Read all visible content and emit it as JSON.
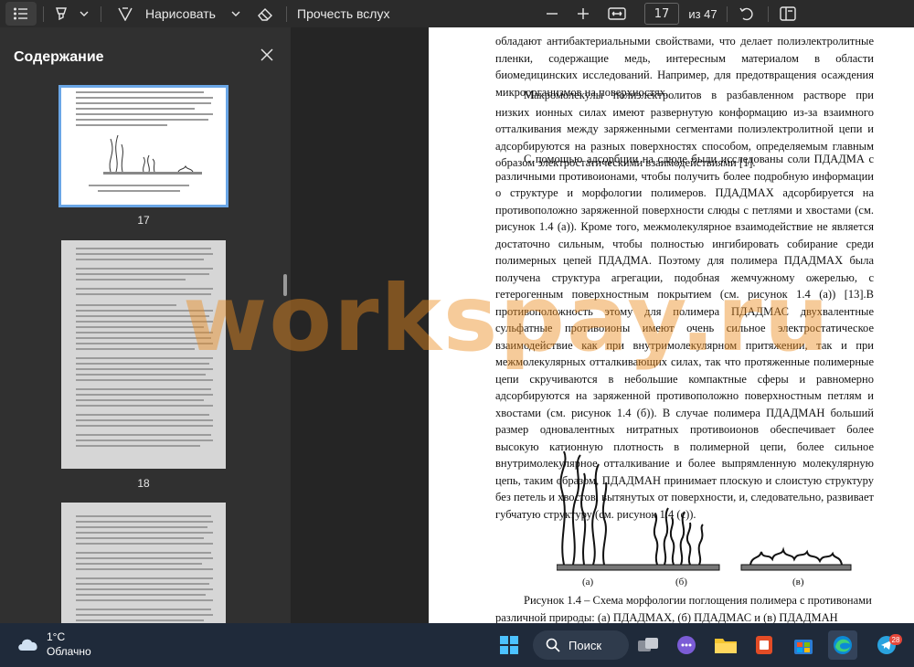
{
  "toolbar": {
    "draw_label": "Нарисовать",
    "read_aloud_label": "Прочесть вслух",
    "page_current": "17",
    "page_total": "из 47"
  },
  "sidebar": {
    "title": "Содержание",
    "thumbnails": [
      {
        "page": "17"
      },
      {
        "page": "18"
      }
    ]
  },
  "document": {
    "paragraphs": [
      "обладают антибактериальными свойствами, что делает полиэлектролитные пленки, содержащие медь, интересным материалом в области биомедицинских исследований. Например, для предотвращения осаждения микроорганизмов на поверхностях.",
      "Макромолекулы полиэлектролитов в разбавленном растворе при низких ионных силах имеют развернутую конформацию из-за взаимного отталкивания между заряженными сегментами полиэлектролитной цепи и адсорбируются на разных поверхностях способом, определяемым главным образом электростатическими взаимодействиями [1].",
      "С помощью адсорбции на слюде были исследованы соли ПДАДМА с различными противоионами, чтобы получить более подробную информации о структуре и морфологии полимеров. ПДАДМАХ адсорбируется на противоположно заряженной поверхности слюды с петлями и хвостами (см. рисунок 1.4 (а)). Кроме того, межмолекулярное взаимодействие не является достаточно сильным, чтобы полностью ингибировать собирание среди полимерных цепей ПДАДМА. Поэтому для полимера ПДАДМАХ была получена структура агрегации, подобная жемчужному ожерелью, с гетерогенным поверхностным покрытием (см. рисунок 1.4 (а)) [13].В противоположность этому для полимера ПДАДМАС двухвалентные сульфатные противоионы имеют очень сильное электростатическое взаимодействие как при внутримолекулярном притяжении, так и при межмолекулярных отталкивающих силах, так что протяженные полимерные цепи скручиваются в небольшие компактные сферы и равномерно адсорбируются на заряженной противоположно поверхностным петлям и хвостами (см. рисунок 1.4 (б)). В случае полимера ПДАДМАН больший размер одновалентных нитратных противоионов обеспечивает более высокую катионную плотность в полимерной цепи, более сильное внутримолекулярное отталкивание и более выпрямленную молекулярную цепь, таким образом, ПДАДМАН принимает плоскую и слоистую структуру без петель и хвостов, вытянутых от поверхности, и, следовательно, развивает губчатую структуру (см. рисунок 1.4 (с))."
    ],
    "figure_labels": [
      "(а)",
      "(б)",
      "(в)"
    ],
    "caption": "Рисунок 1.4 – Схема морфологии поглощения полимера с противонами различной природы: (а) ПДАДМАХ, (б) ПДАДМАС и (в) ПДАДМАН"
  },
  "watermark": "workspay.ru",
  "taskbar": {
    "temperature": "1°C",
    "condition": "Облачно",
    "search_label": "Поиск",
    "telegram_badge": "28"
  }
}
